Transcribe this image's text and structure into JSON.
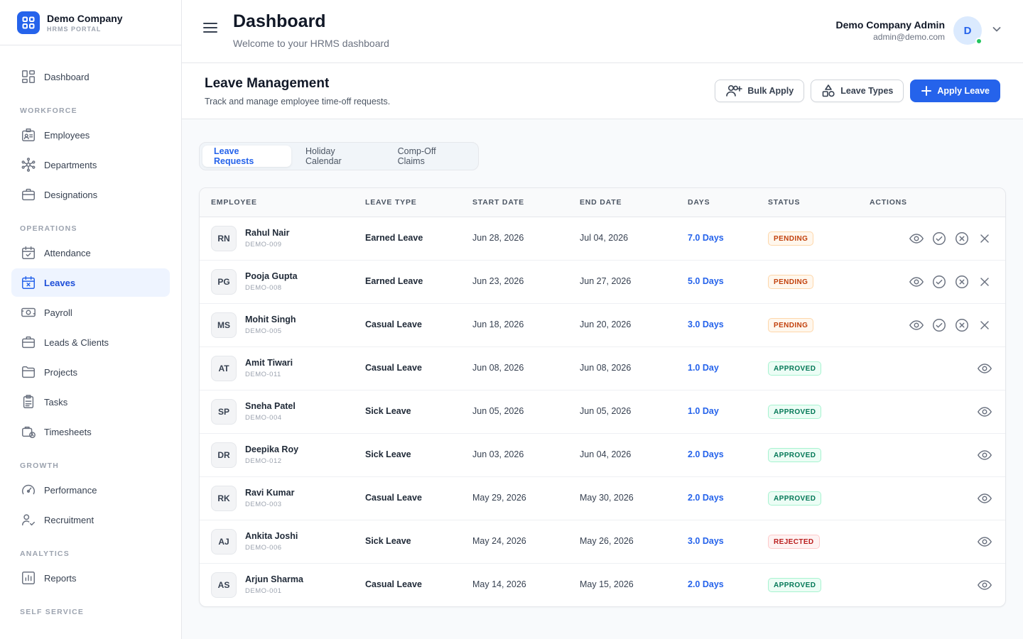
{
  "brand": {
    "name": "Demo Company",
    "subtitle": "HRMS PORTAL"
  },
  "sidebar": {
    "top": [
      {
        "label": "Dashboard",
        "icon": "dashboard-icon"
      }
    ],
    "sections": [
      {
        "title": "WORKFORCE",
        "items": [
          {
            "label": "Employees",
            "icon": "id-card-icon"
          },
          {
            "label": "Departments",
            "icon": "network-icon"
          },
          {
            "label": "Designations",
            "icon": "briefcase-icon"
          }
        ]
      },
      {
        "title": "OPERATIONS",
        "items": [
          {
            "label": "Attendance",
            "icon": "calendar-check-icon"
          },
          {
            "label": "Leaves",
            "icon": "calendar-x-icon",
            "active": true
          },
          {
            "label": "Payroll",
            "icon": "money-icon"
          },
          {
            "label": "Leads & Clients",
            "icon": "briefcase-icon"
          },
          {
            "label": "Projects",
            "icon": "folder-icon"
          },
          {
            "label": "Tasks",
            "icon": "clipboard-icon"
          },
          {
            "label": "Timesheets",
            "icon": "briefcase-clock-icon"
          }
        ]
      },
      {
        "title": "GROWTH",
        "items": [
          {
            "label": "Performance",
            "icon": "gauge-icon"
          },
          {
            "label": "Recruitment",
            "icon": "user-check-icon"
          }
        ]
      },
      {
        "title": "ANALYTICS",
        "items": [
          {
            "label": "Reports",
            "icon": "bar-chart-icon"
          }
        ]
      },
      {
        "title": "SELF SERVICE",
        "items": []
      }
    ]
  },
  "header": {
    "title": "Dashboard",
    "subtitle": "Welcome to your HRMS dashboard",
    "user_name": "Demo Company Admin",
    "user_email": "admin@demo.com",
    "avatar_letter": "D",
    "online_color": "#22c55e"
  },
  "page": {
    "title": "Leave Management",
    "description": "Track and manage employee time-off requests.",
    "bulk_apply": "Bulk Apply",
    "leave_types": "Leave Types",
    "apply_leave": "Apply Leave",
    "accent": "#2563eb"
  },
  "tabs": [
    {
      "label": "Leave Requests",
      "active": true
    },
    {
      "label": "Holiday Calendar",
      "active": false
    },
    {
      "label": "Comp-Off Claims",
      "active": false
    }
  ],
  "table": {
    "headers": {
      "employee": "EMPLOYEE",
      "leave_type": "LEAVE TYPE",
      "start": "START DATE",
      "end": "END DATE",
      "days": "DAYS",
      "status": "STATUS",
      "actions": "ACTIONS"
    },
    "rows": [
      {
        "initials": "RN",
        "name": "Rahul Nair",
        "code": "DEMO-009",
        "type": "Earned Leave",
        "start": "Jun 28, 2026",
        "end": "Jul 04, 2026",
        "days": "7.0 Days",
        "status": "PENDING"
      },
      {
        "initials": "PG",
        "name": "Pooja Gupta",
        "code": "DEMO-008",
        "type": "Earned Leave",
        "start": "Jun 23, 2026",
        "end": "Jun 27, 2026",
        "days": "5.0 Days",
        "status": "PENDING"
      },
      {
        "initials": "MS",
        "name": "Mohit Singh",
        "code": "DEMO-005",
        "type": "Casual Leave",
        "start": "Jun 18, 2026",
        "end": "Jun 20, 2026",
        "days": "3.0 Days",
        "status": "PENDING"
      },
      {
        "initials": "AT",
        "name": "Amit Tiwari",
        "code": "DEMO-011",
        "type": "Casual Leave",
        "start": "Jun 08, 2026",
        "end": "Jun 08, 2026",
        "days": "1.0 Day",
        "status": "APPROVED"
      },
      {
        "initials": "SP",
        "name": "Sneha Patel",
        "code": "DEMO-004",
        "type": "Sick Leave",
        "start": "Jun 05, 2026",
        "end": "Jun 05, 2026",
        "days": "1.0 Day",
        "status": "APPROVED"
      },
      {
        "initials": "DR",
        "name": "Deepika Roy",
        "code": "DEMO-012",
        "type": "Sick Leave",
        "start": "Jun 03, 2026",
        "end": "Jun 04, 2026",
        "days": "2.0 Days",
        "status": "APPROVED"
      },
      {
        "initials": "RK",
        "name": "Ravi Kumar",
        "code": "DEMO-003",
        "type": "Casual Leave",
        "start": "May 29, 2026",
        "end": "May 30, 2026",
        "days": "2.0 Days",
        "status": "APPROVED"
      },
      {
        "initials": "AJ",
        "name": "Ankita Joshi",
        "code": "DEMO-006",
        "type": "Sick Leave",
        "start": "May 24, 2026",
        "end": "May 26, 2026",
        "days": "3.0 Days",
        "status": "REJECTED"
      },
      {
        "initials": "AS",
        "name": "Arjun Sharma",
        "code": "DEMO-001",
        "type": "Casual Leave",
        "start": "May 14, 2026",
        "end": "May 15, 2026",
        "days": "2.0 Days",
        "status": "APPROVED"
      }
    ]
  }
}
